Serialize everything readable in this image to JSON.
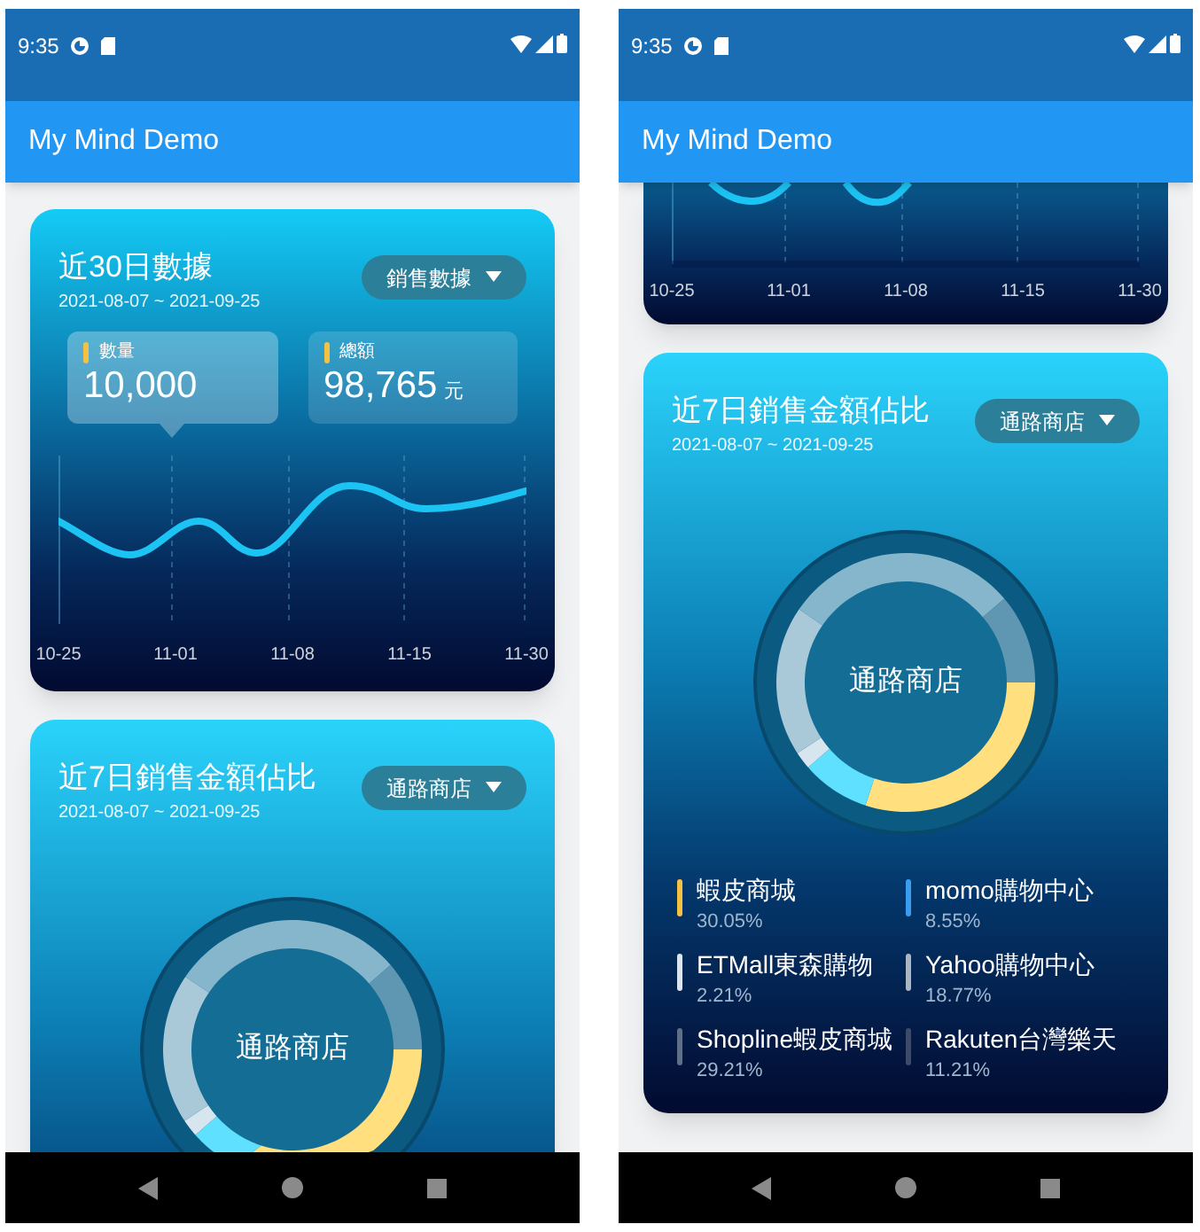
{
  "phones": [
    {
      "status_bar": {
        "time": "9:35"
      },
      "app_bar": {
        "title": "My Mind Demo"
      },
      "cards": [
        {
          "kind": "summary",
          "title": "近30日數據",
          "date_range": "2021-08-07 ~ 2021-09-25",
          "dropdown": "銷售數據",
          "stats": [
            {
              "label": "數量",
              "value": "10,000",
              "selected": true
            },
            {
              "label": "總額",
              "value": "98,765",
              "unit": "元",
              "selected": false
            }
          ],
          "x_labels": [
            "10-25",
            "11-01",
            "11-08",
            "11-15",
            "11-30"
          ]
        },
        {
          "kind": "share",
          "title": "近7日銷售金額佔比",
          "date_range": "2021-08-07 ~ 2021-09-25",
          "dropdown": "通路商店",
          "center_label": "通路商店"
        }
      ]
    },
    {
      "status_bar": {
        "time": "9:35"
      },
      "app_bar": {
        "title": "My Mind Demo"
      },
      "cards": [
        {
          "kind": "chart_tail",
          "x_labels": [
            "10-25",
            "11-01",
            "11-08",
            "11-15",
            "11-30"
          ]
        },
        {
          "kind": "share",
          "title": "近7日銷售金額佔比",
          "date_range": "2021-08-07 ~ 2021-09-25",
          "dropdown": "通路商店",
          "center_label": "通路商店",
          "chart_data": {
            "type": "donut",
            "values": [
              30.05,
              8.55,
              2.21,
              18.77,
              29.21,
              11.21
            ],
            "colors": [
              "#ffdf7e",
              "#5fe0ff",
              "#d7e6ee",
              "#a9c9d9",
              "#85b6cc",
              "#5f97b3"
            ]
          },
          "legend": [
            {
              "name": "蝦皮商城",
              "percent": "30.05%",
              "color": "#f5c142"
            },
            {
              "name": "momo購物中心",
              "percent": "8.55%",
              "color": "#3a9ef0"
            },
            {
              "name": "ETMall東森購物",
              "percent": "2.21%",
              "color": "#dde6ee"
            },
            {
              "name": "Yahoo購物中心",
              "percent": "18.77%",
              "color": "#aab6c2"
            },
            {
              "name": "Shopline蝦皮商城",
              "percent": "29.21%",
              "color": "#5f6f88"
            },
            {
              "name": "Rakuten台灣樂天",
              "percent": "11.21%",
              "color": "#3d4b68"
            }
          ]
        }
      ]
    }
  ]
}
